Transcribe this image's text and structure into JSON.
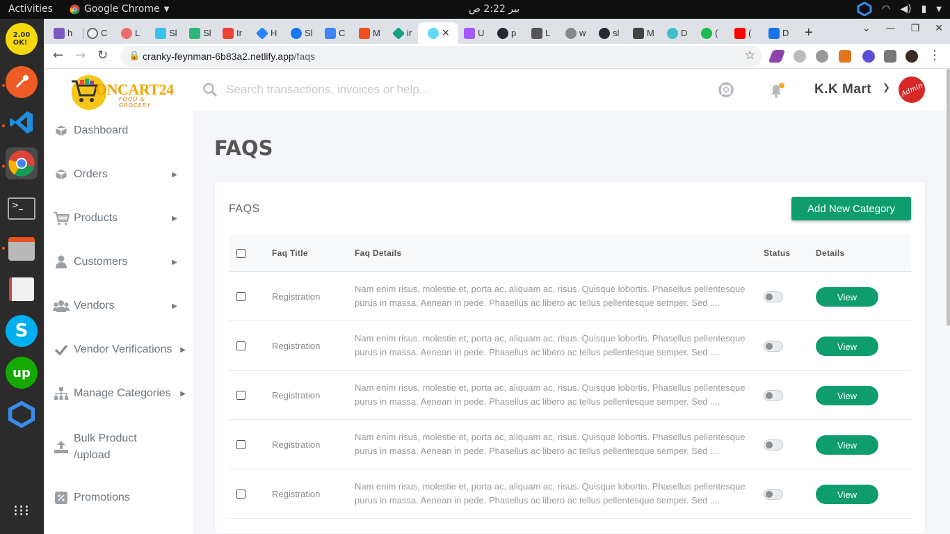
{
  "system": {
    "activities": "Activities",
    "app_name": "Google Chrome",
    "clock": "بير 2:22 ص"
  },
  "browser": {
    "tabs": [
      "h",
      "C",
      "L",
      "Sl",
      "Sl",
      "Ir",
      "H",
      "Sl",
      "C",
      "M",
      "ir",
      "",
      "U",
      "p",
      "L",
      "w",
      "sl",
      "M",
      "D",
      "(",
      "(",
      "D"
    ],
    "url_host": "cranky-feynman-6b83a2.netlify.app",
    "url_path": "/faqs"
  },
  "sidebar": {
    "logo_text": "ONCART24",
    "logo_sub": "FOOD & GROCERY",
    "items": [
      {
        "label": "Dashboard",
        "icon": "box-icon"
      },
      {
        "label": "Orders",
        "icon": "box-icon"
      },
      {
        "label": "Products",
        "icon": "cart-icon"
      },
      {
        "label": "Customers",
        "icon": "user-icon"
      },
      {
        "label": "Vendors",
        "icon": "users-icon"
      },
      {
        "label": "Vendor Verifications",
        "icon": "check-icon"
      },
      {
        "label": "Manage Categories",
        "icon": "sitemap-icon"
      },
      {
        "label": "Bulk Product /upload",
        "icon": "upload-icon"
      },
      {
        "label": "Promotions",
        "icon": "percent-icon"
      }
    ]
  },
  "header": {
    "search_placeholder": "Search transactions, invoices or help...",
    "user_name": "K.K Mart",
    "avatar_text": "Admin"
  },
  "page": {
    "title": "FAQS",
    "card_title": "FAQS",
    "add_button": "Add New Category"
  },
  "table": {
    "headers": {
      "title": "Faq Title",
      "details": "Faq Details",
      "status": "Status",
      "actions": "Details"
    },
    "rows": [
      {
        "title": "Registration",
        "details": "Nam enim risus, molestie et, porta ac, aliquam ac, risus. Quisque lobortis. Phasellus pellentesque purus in massa. Aenean in pede. Phasellus ac libero ac tellus pellentesque semper. Sed ....",
        "view": "View"
      },
      {
        "title": "Registration",
        "details": "Nam enim risus, molestie et, porta ac, aliquam ac, risus. Quisque lobortis. Phasellus pellentesque purus in massa. Aenean in pede. Phasellus ac libero ac tellus pellentesque semper. Sed ....",
        "view": "View"
      },
      {
        "title": "Registration",
        "details": "Nam enim risus, molestie et, porta ac, aliquam ac, risus. Quisque lobortis. Phasellus pellentesque purus in massa. Aenean in pede. Phasellus ac libero ac tellus pellentesque semper. Sed ....",
        "view": "View"
      },
      {
        "title": "Registration",
        "details": "Nam enim risus, molestie et, porta ac, aliquam ac, risus. Quisque lobortis. Phasellus pellentesque purus in massa. Aenean in pede. Phasellus ac libero ac tellus pellentesque semper. Sed ....",
        "view": "View"
      },
      {
        "title": "Registration",
        "details": "Nam enim risus, molestie et, porta ac, aliquam ac, risus. Quisque lobortis. Phasellus pellentesque purus in massa. Aenean in pede. Phasellus ac libero ac tellus pellentesque semper. Sed ....",
        "view": "View"
      }
    ]
  },
  "colors": {
    "accent": "#0f9d6e",
    "avatar": "#d62828",
    "logo": "#f5c518"
  }
}
